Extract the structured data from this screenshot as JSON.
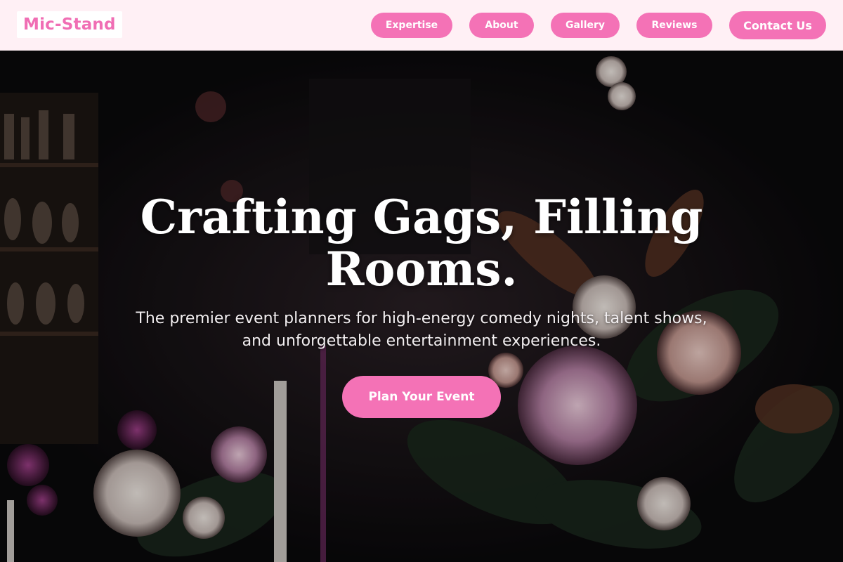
{
  "header": {
    "logo": "Mic-Stand",
    "nav": {
      "expertise": "Expertise",
      "about": "About",
      "gallery": "Gallery",
      "reviews": "Reviews",
      "contact": "Contact Us"
    }
  },
  "hero": {
    "title_line1": "Crafting Gags, Filling",
    "title_line2": "Rooms.",
    "subtitle": "The premier event planners for high-energy comedy nights, talent shows, and unforgettable entertainment experiences.",
    "cta": "Plan Your Event"
  },
  "colors": {
    "accent": "#f472b6",
    "header_bg": "#fff0f5",
    "logo_text": "#f06eb4"
  }
}
